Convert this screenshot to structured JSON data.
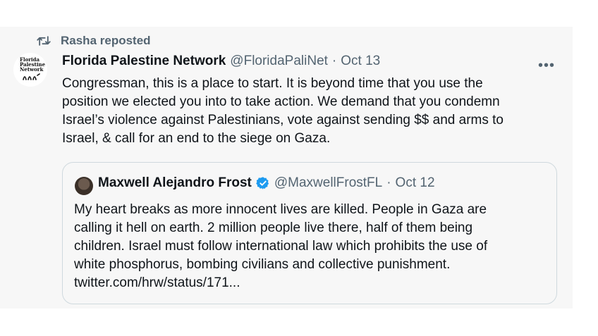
{
  "repost": {
    "text": "Rasha reposted"
  },
  "tweet": {
    "display_name": "Florida Palestine Network",
    "handle": "@FloridaPaliNet",
    "separator": "·",
    "date": "Oct 13",
    "avatar_logo_text": "Florida\nPalestine\nNetwork",
    "more_label": "•••",
    "text": "Congressman, this is a place to start. It is beyond time that you use the\nposition we elected you into to take action. We demand that you condemn\nIsrael’s violence against Palestinians, vote against sending $$ and arms to\nIsrael, & call for an end to the siege on Gaza."
  },
  "quote": {
    "display_name": "Maxwell Alejandro Frost",
    "handle": "@MaxwellFrostFL",
    "separator": "·",
    "date": "Oct 12",
    "text": "My heart breaks as more innocent lives are killed. People in Gaza are\ncalling it hell on earth. 2 million people live there, half of them being\nchildren. Israel must follow international law which prohibits the use of\nwhite phosphorus, bombing civilians and collective punishment.\ntwitter.com/hrw/status/171..."
  },
  "colors": {
    "card_background": "#f7f7f7",
    "secondary_text": "#536471",
    "primary_text": "#0f1419",
    "verified_badge": "#1d9bf0",
    "quote_border": "#cfd9de"
  },
  "icons": {
    "repost": "repost-icon",
    "more": "more-options-icon",
    "verified": "verified-badge-icon"
  }
}
